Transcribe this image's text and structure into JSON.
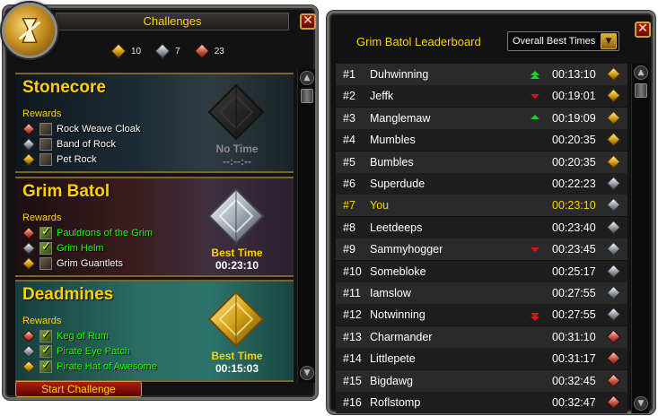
{
  "colors": {
    "gold": "#ffd100",
    "earned": "#1eff00",
    "accent_red": "#b01d12"
  },
  "challenges": {
    "title": "Challenges",
    "close_label": "✕",
    "currency": [
      {
        "medal": "gold",
        "count": "10"
      },
      {
        "medal": "silver",
        "count": "7"
      },
      {
        "medal": "bronze",
        "count": "23"
      }
    ],
    "dungeons": [
      {
        "name": "Stonecore",
        "rewards_label": "Rewards",
        "medal": "none",
        "best_label": "No Time",
        "best_time": "--:--:--",
        "rewards": [
          {
            "medal": "bronze",
            "item": "Rock Weave Cloak",
            "earned": false
          },
          {
            "medal": "silver",
            "item": "Band of Rock",
            "earned": false
          },
          {
            "medal": "gold",
            "item": "Pet Rock",
            "earned": false
          }
        ]
      },
      {
        "name": "Grim Batol",
        "rewards_label": "Rewards",
        "medal": "silver",
        "best_label": "Best Time",
        "best_time": "00:23:10",
        "rewards": [
          {
            "medal": "bronze",
            "item": "Pauldrons of the Grim",
            "earned": true
          },
          {
            "medal": "silver",
            "item": "Grim Helm",
            "earned": true
          },
          {
            "medal": "gold",
            "item": "Grim Guantlets",
            "earned": false
          }
        ]
      },
      {
        "name": "Deadmines",
        "rewards_label": "Rewards",
        "medal": "gold",
        "best_label": "Best Time",
        "best_time": "00:15:03",
        "rewards": [
          {
            "medal": "bronze",
            "item": "Keg of Rum",
            "earned": true
          },
          {
            "medal": "silver",
            "item": "Pirate Eye Patch",
            "earned": true
          },
          {
            "medal": "gold",
            "item": "Pirate Hat of Awesome",
            "earned": true
          }
        ]
      }
    ],
    "start_button": "Start Challenge",
    "scroll_up": "▲",
    "scroll_down": "▼"
  },
  "leaderboard": {
    "title": "Grim Batol Leaderboard",
    "sort_selected": "Overall Best Times",
    "sort_arrow": "▼",
    "close_label": "✕",
    "scroll_up": "▲",
    "scroll_down": "▼",
    "rows": [
      {
        "rank": "#1",
        "name": "Duhwinning",
        "trend": "up2",
        "time": "00:13:10",
        "medal": "gold"
      },
      {
        "rank": "#2",
        "name": "Jeffk",
        "trend": "down",
        "time": "00:19:01",
        "medal": "gold"
      },
      {
        "rank": "#3",
        "name": "Manglemaw",
        "trend": "up",
        "time": "00:19:09",
        "medal": "gold"
      },
      {
        "rank": "#4",
        "name": "Mumbles",
        "trend": "",
        "time": "00:20:35",
        "medal": "gold"
      },
      {
        "rank": "#5",
        "name": "Bumbles",
        "trend": "",
        "time": "00:20:35",
        "medal": "gold"
      },
      {
        "rank": "#6",
        "name": "Superdude",
        "trend": "",
        "time": "00:22:23",
        "medal": "silver"
      },
      {
        "rank": "#7",
        "name": "You",
        "trend": "",
        "time": "00:23:10",
        "medal": "silver",
        "is_player": true
      },
      {
        "rank": "#8",
        "name": "Leetdeeps",
        "trend": "",
        "time": "00:23:40",
        "medal": "silver"
      },
      {
        "rank": "#9",
        "name": "Sammyhogger",
        "trend": "down",
        "time": "00:23:45",
        "medal": "silver"
      },
      {
        "rank": "#10",
        "name": "Somebloke",
        "trend": "",
        "time": "00:25:17",
        "medal": "silver"
      },
      {
        "rank": "#11",
        "name": "Iamslow",
        "trend": "",
        "time": "00:27:55",
        "medal": "silver"
      },
      {
        "rank": "#12",
        "name": "Notwinning",
        "trend": "down2",
        "time": "00:27:55",
        "medal": "silver"
      },
      {
        "rank": "#13",
        "name": "Charmander",
        "trend": "",
        "time": "00:31:10",
        "medal": "bronze"
      },
      {
        "rank": "#14",
        "name": "Littlepete",
        "trend": "",
        "time": "00:31:17",
        "medal": "bronze"
      },
      {
        "rank": "#15",
        "name": "Bigdawg",
        "trend": "",
        "time": "00:32:45",
        "medal": "bronze"
      },
      {
        "rank": "#16",
        "name": "Roflstomp",
        "trend": "",
        "time": "00:32:47",
        "medal": "bronze"
      }
    ]
  }
}
